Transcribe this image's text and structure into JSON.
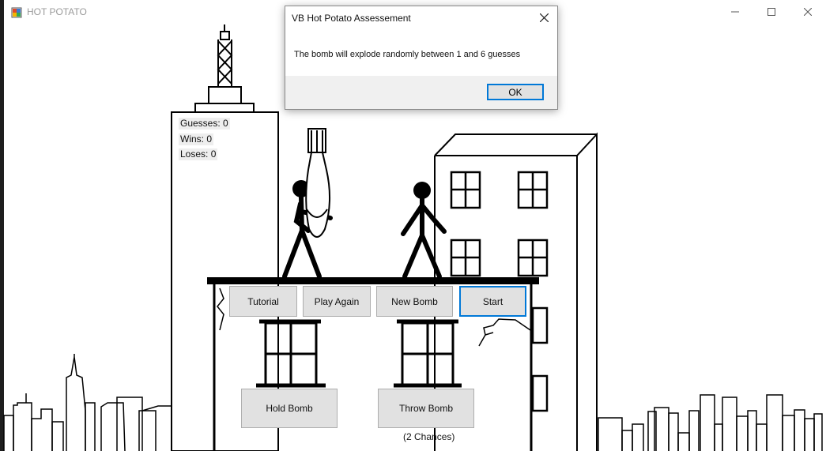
{
  "window": {
    "title": "HOT POTATO",
    "icon": "app-window-icon",
    "controls": [
      "minimize-icon",
      "maximize-icon",
      "close-icon"
    ]
  },
  "stats": {
    "guesses": "Guesses: 0",
    "wins": "Wins: 0",
    "loses": "Loses: 0"
  },
  "buttons": {
    "tutorial": "Tutorial",
    "play_again": "Play Again",
    "new_bomb": "New Bomb",
    "start": "Start",
    "hold_bomb": "Hold Bomb",
    "throw_bomb": "Throw Bomb"
  },
  "chances": "(2 Chances)",
  "dialog": {
    "title": "VB Hot Potato Assessement",
    "message": "The bomb will explode randomly between 1 and 6 guesses",
    "ok": "OK"
  },
  "colors": {
    "focus": "#0078d7",
    "button_face": "#e1e1e1",
    "label_bg": "#eeeeee",
    "dialog_footer": "#f0f0f0"
  }
}
